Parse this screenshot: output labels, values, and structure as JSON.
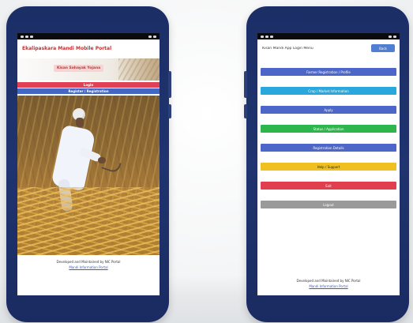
{
  "phones": {
    "left": {
      "app_title": "Ekalipaskara Mandi Mobile Portal",
      "banner_label": "Kisan Sahayak Yojana",
      "bars": [
        "Login",
        "Register / Registration"
      ],
      "footer": {
        "line1": "Developed and Maintained by NIC Portal",
        "link": "Mandi Information Portal"
      }
    },
    "right": {
      "header_title": "Kisan Mandi App Login Menu",
      "header_button": "Back",
      "menu_items": [
        "Farmer Registration / Profile",
        "Crop / Market Information",
        "Apply",
        "Status / Application",
        "Registration Details",
        "Help / Support",
        "Exit",
        "Logout"
      ],
      "footer": {
        "line1": "Developed and Maintained by NIC Portal",
        "link": "Mandi Information Portal"
      }
    }
  },
  "colors": {
    "device_body": "#1f3470",
    "left_title_red": "#c43131",
    "bar_red": "#e04155",
    "bar_blue": "#4467c4",
    "menu_blue": "#4d67c8",
    "menu_teal": "#2aa7dc",
    "menu_green": "#2eb54b",
    "menu_yellow": "#f0c020",
    "menu_red": "#e13e4e",
    "menu_gray": "#9a9a9a"
  }
}
